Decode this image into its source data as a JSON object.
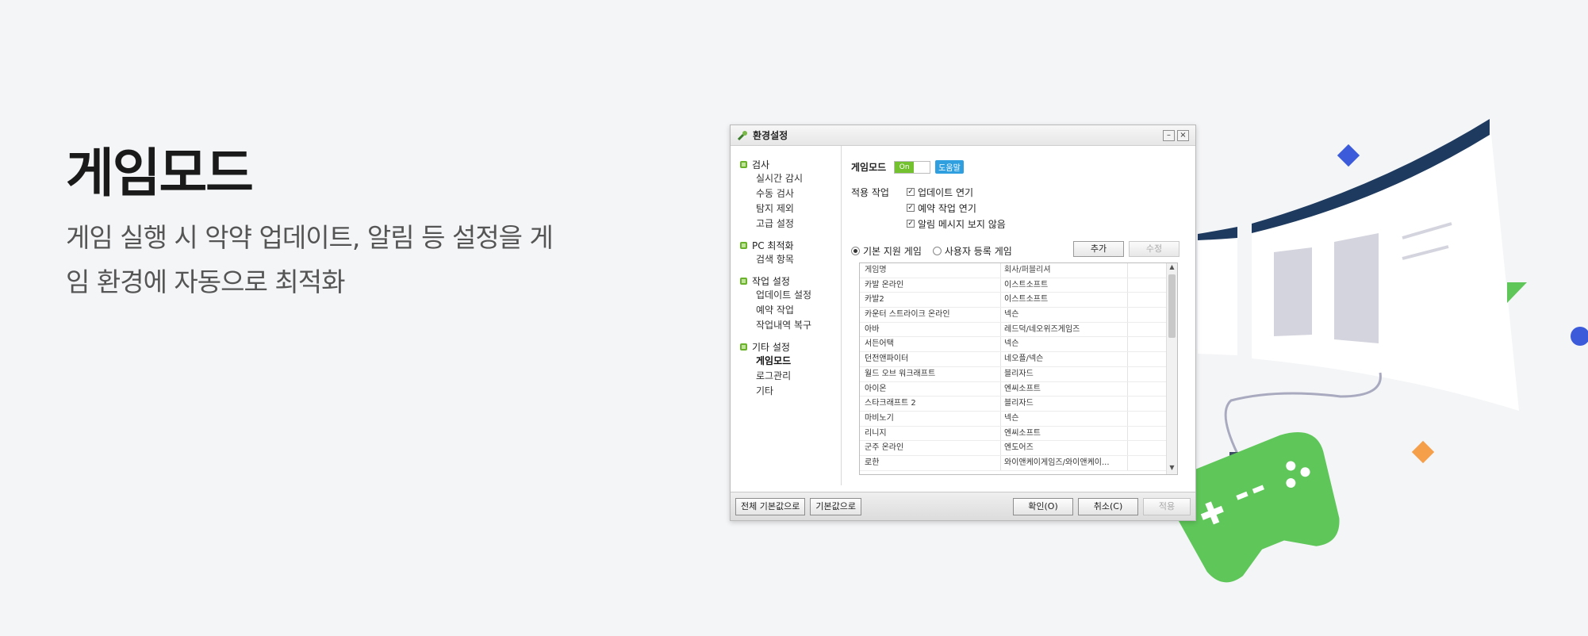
{
  "hero": {
    "title": "게임모드",
    "description": "게임 실행 시 악약 업데이트, 알림 등 설정을 게임 환경에 자동으로 최적화"
  },
  "dialog": {
    "title": "환경설정",
    "min_glyph": "–",
    "close_glyph": "×",
    "nav": [
      {
        "group": "검사",
        "items": [
          "실시간 감시",
          "수동 검사",
          "탐지 제외",
          "고급 설정"
        ]
      },
      {
        "group": "PC 최적화",
        "items": [
          "검색 항목"
        ]
      },
      {
        "group": "작업 설정",
        "items": [
          "업데이트 설정",
          "예약 작업",
          "작업내역 복구"
        ]
      },
      {
        "group": "기타 설정",
        "items": [
          "게임모드",
          "로그관리",
          "기타"
        ]
      }
    ],
    "game_mode_label": "게임모드",
    "toggle_on": "On",
    "help_label": "도움말",
    "apply_label": "적용 작업",
    "checks": [
      "업데이트 연기",
      "예약 작업 연기",
      "알림 메시지 보지 않음"
    ],
    "radio_default": "기본 지원 게임",
    "radio_user": "사용자 등록 게임",
    "add_label": "추가",
    "edit_label": "수정",
    "table_headers": [
      "게임명",
      "회사/퍼블리셔"
    ],
    "games": [
      [
        "카발 온라인",
        "이스트소프트"
      ],
      [
        "카발2",
        "이스트소프트"
      ],
      [
        "카운터 스트라이크 온라인",
        "넥슨"
      ],
      [
        "아바",
        "레드덕/네오위즈게임즈"
      ],
      [
        "서든어택",
        "넥슨"
      ],
      [
        "던전앤파이터",
        "네오플/넥슨"
      ],
      [
        "월드 오브 워크래프트",
        "블리자드"
      ],
      [
        "아이온",
        "엔씨소프트"
      ],
      [
        "스타크래프트 2",
        "블리자드"
      ],
      [
        "마비노기",
        "넥슨"
      ],
      [
        "리니지",
        "엔씨소프트"
      ],
      [
        "군주 온라인",
        "엔도어즈"
      ],
      [
        "로한",
        "와이앤케이게임즈/와이앤케이..."
      ]
    ],
    "footer": {
      "reset_all": "전체 기본값으로",
      "reset": "기본값으로",
      "ok": "확인(O)",
      "cancel": "취소(C)",
      "apply": "적용"
    }
  },
  "colors": {
    "background": "#f4f5f7",
    "green": "#5fc75a",
    "navy": "#1e3a5f",
    "blue": "#3b5bdb",
    "orange": "#f59f4a"
  }
}
